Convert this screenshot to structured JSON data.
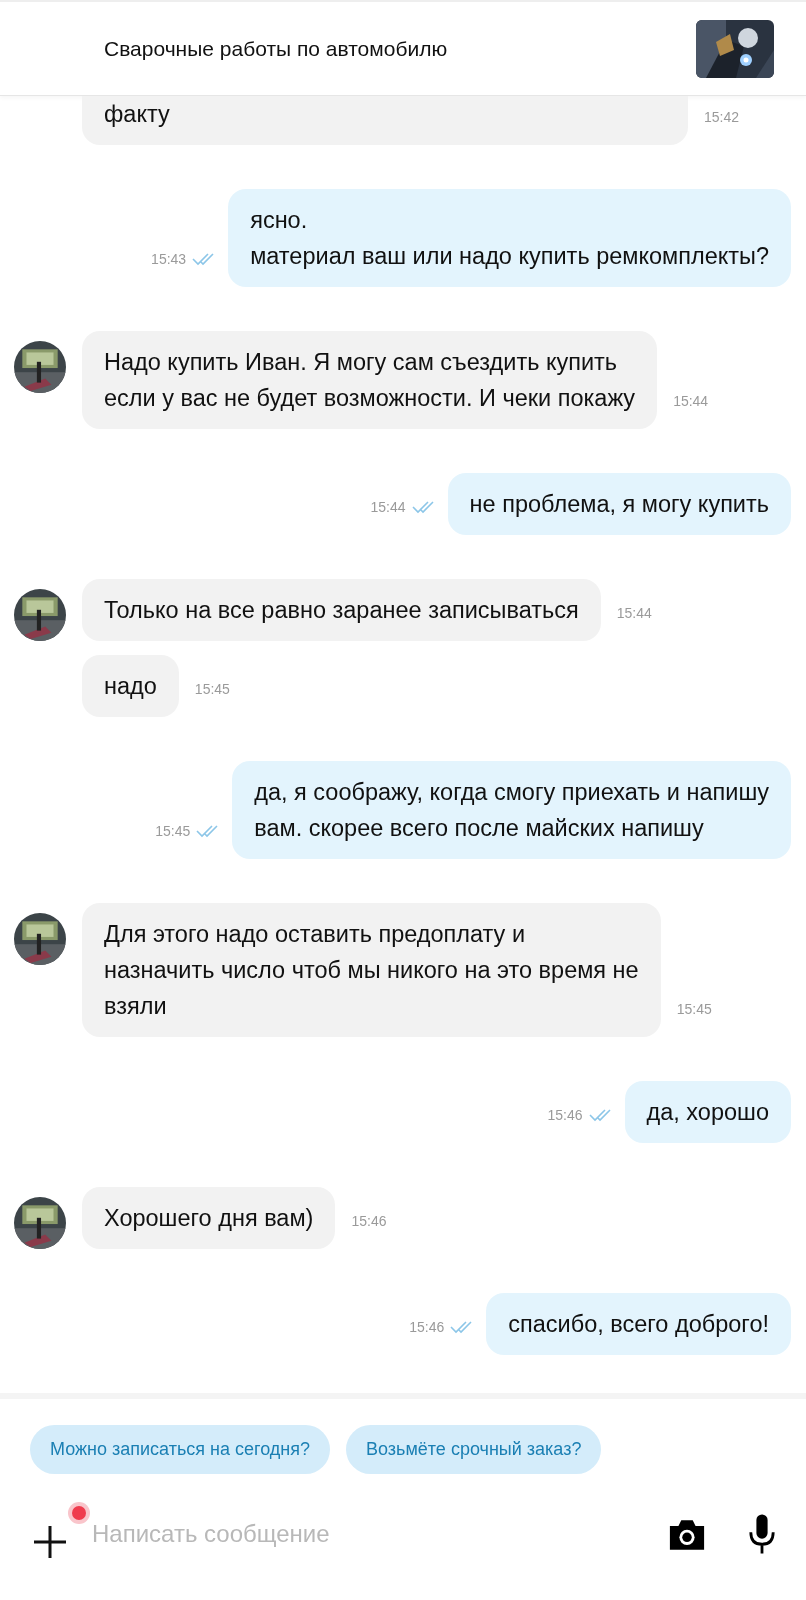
{
  "header": {
    "title": "Сварочные работы по автомобилю"
  },
  "messages": [
    {
      "kind": "incoming",
      "text": "факту",
      "time": "15:42",
      "avatar": false
    },
    {
      "kind": "outgoing",
      "text": "ясно.\nматериал ваш или надо купить ремкомплекты?",
      "time": "15:43",
      "read": true
    },
    {
      "kind": "incoming",
      "text": "Надо купить Иван. Я могу сам съездить купить\nесли у вас не будет возможности. И чеки покажу",
      "time": "15:44",
      "avatar": true
    },
    {
      "kind": "outgoing",
      "text": "не проблема, я могу купить",
      "time": "15:44",
      "read": true
    },
    {
      "kind": "incoming",
      "text": "Только на все равно заранее записываться",
      "time": "15:44",
      "avatar": true
    },
    {
      "kind": "incoming",
      "text": "надо",
      "time": "15:45",
      "avatar": false
    },
    {
      "kind": "outgoing",
      "text": "да, я соображу, когда смогу приехать и напишу\nвам. скорее всего после майских напишу",
      "time": "15:45",
      "read": true
    },
    {
      "kind": "incoming",
      "text": "Для этого надо оставить предоплату и\nназначить число чтоб мы никого на это время не\nвзяли",
      "time": "15:45",
      "avatar": true
    },
    {
      "kind": "outgoing",
      "text": "да, хорошо",
      "time": "15:46",
      "read": true
    },
    {
      "kind": "incoming",
      "text": "Хорошего дня вам)",
      "time": "15:46",
      "avatar": true
    },
    {
      "kind": "outgoing",
      "text": "спасибо, всего доброго!",
      "time": "15:46",
      "read": true
    }
  ],
  "quick_replies": [
    "Можно записаться на сегодня?",
    "Возьмёте срочный заказ?"
  ],
  "composer": {
    "placeholder": "Написать сообщение",
    "attach_badge": true
  }
}
